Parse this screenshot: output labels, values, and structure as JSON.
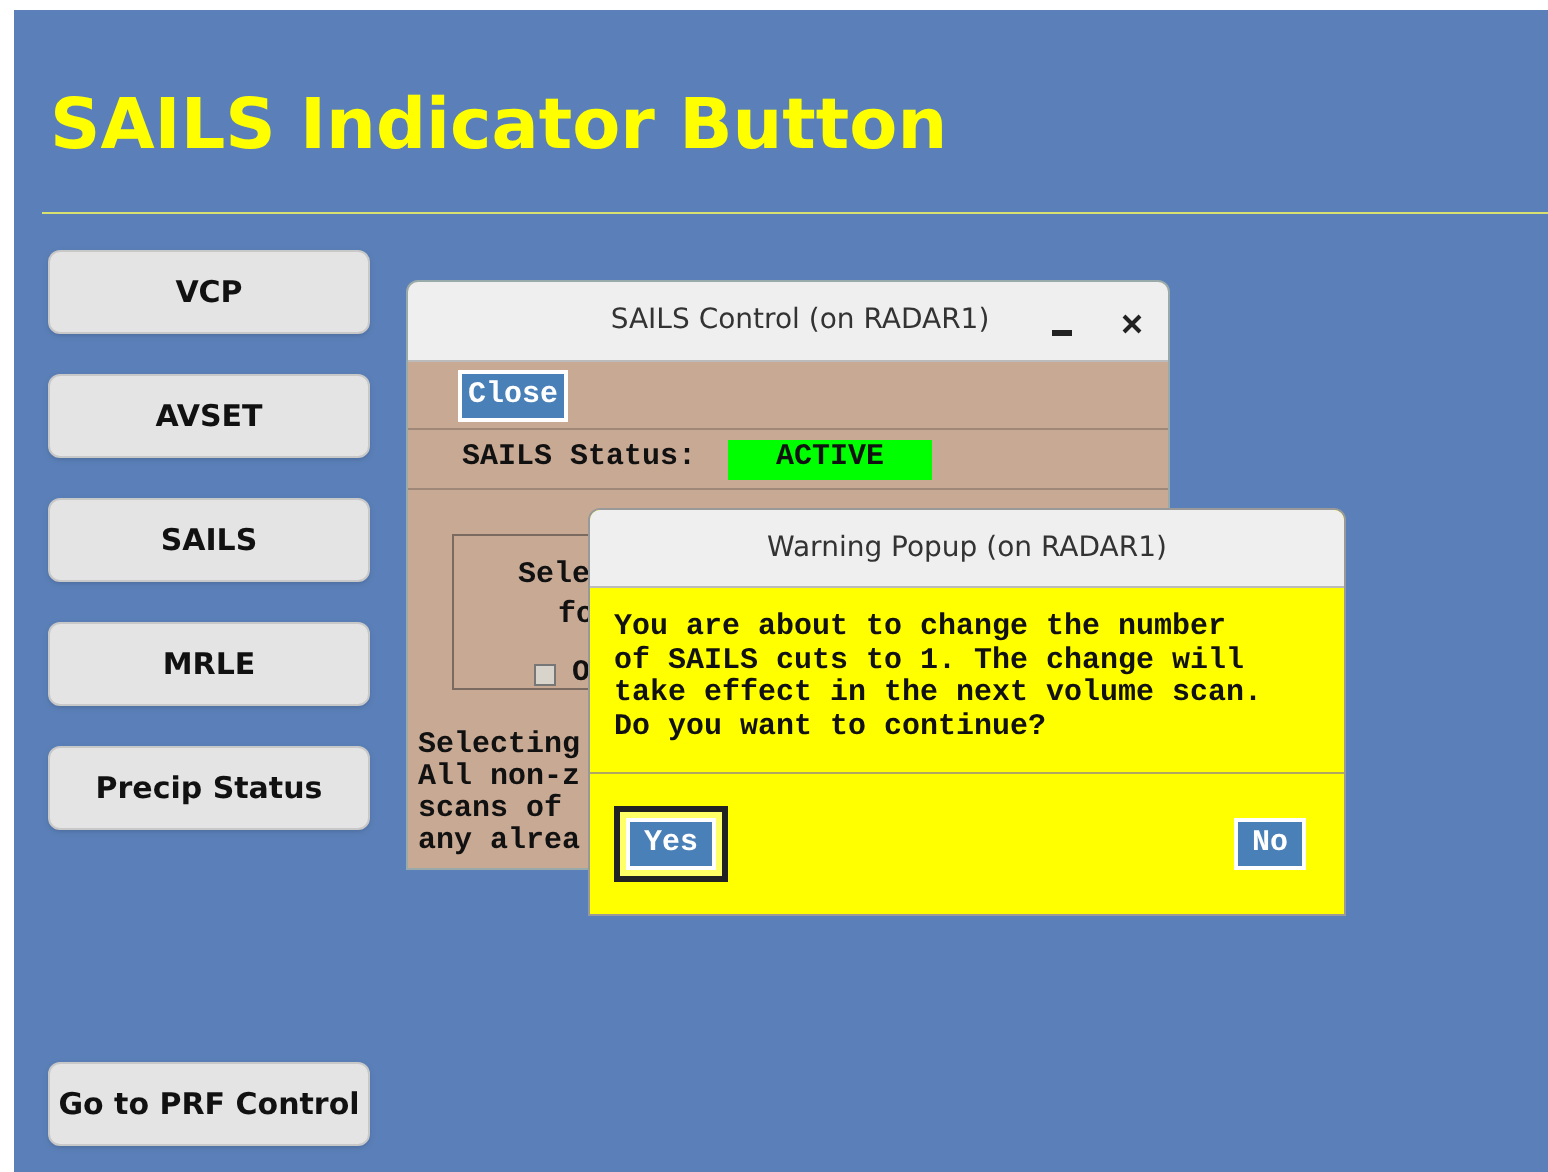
{
  "page": {
    "title": "SAILS Indicator Button"
  },
  "nav_buttons": [
    {
      "label": "VCP"
    },
    {
      "label": "AVSET"
    },
    {
      "label": "SAILS"
    },
    {
      "label": "MRLE"
    },
    {
      "label": "Precip Status"
    }
  ],
  "bottom_button": {
    "label": "Go to PRF Control"
  },
  "sails_window": {
    "title": "SAILS Control (on RADAR1)",
    "close_button": "Close",
    "status_label": "SAILS Status:",
    "status_value": "ACTIVE",
    "group_lines": [
      "Sele",
      "fo"
    ],
    "option": {
      "label": "O",
      "checked": false
    },
    "note_lines": [
      "Selecting",
      "All non-z",
      "scans of",
      "any alrea"
    ]
  },
  "warning_popup": {
    "title": "Warning Popup (on RADAR1)",
    "message": "You are about to change the number\nof SAILS cuts to 1. The change will\ntake effect in the next volume scan.\nDo you want to continue?",
    "buttons": [
      {
        "label": "Yes",
        "selected": true
      },
      {
        "label": "No",
        "selected": false
      }
    ]
  }
}
